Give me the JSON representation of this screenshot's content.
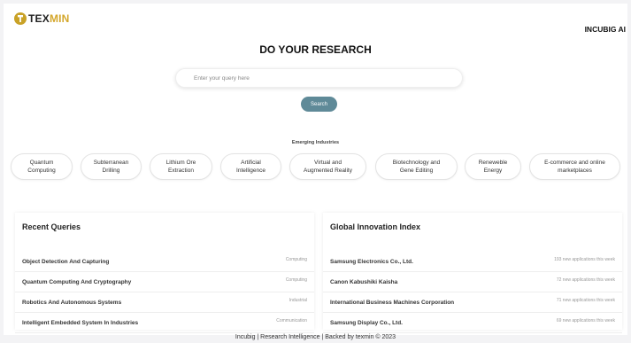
{
  "header": {
    "logo_text_main": "TEX",
    "logo_text_accent": "MIN",
    "brand_right": "INCUBIG AI"
  },
  "hero": {
    "title": "DO YOUR RESEARCH",
    "search_placeholder": "Enter your query here",
    "search_value": "",
    "search_button": "Search"
  },
  "emerging": {
    "label": "Emerging Industries",
    "chips": [
      [
        "Quantum",
        "Computing"
      ],
      [
        "Subterranean",
        "Drilling"
      ],
      [
        "Lithium Ore",
        "Extraction"
      ],
      [
        "Artificial",
        "Intelligence"
      ],
      [
        "Virtual and",
        "Augmented Reality"
      ],
      [
        "Biotechnology and",
        "Gene Editing"
      ],
      [
        "Reneweble",
        "Energy"
      ],
      [
        "E-commerce and online",
        "marketplaces"
      ]
    ]
  },
  "recent_queries": {
    "title": "Recent Queries",
    "rows": [
      {
        "name": "Object Detection And Capturing",
        "meta": "Computing"
      },
      {
        "name": "Quantum Computing And Cryptography",
        "meta": "Computing"
      },
      {
        "name": "Robotics And Autonomous Systems",
        "meta": "Industrial"
      },
      {
        "name": "Intelligent Embedded System In Industries",
        "meta": "Communication"
      }
    ]
  },
  "global_index": {
    "title": "Global Innovation Index",
    "rows": [
      {
        "name": "Samsung Electronics Co., Ltd.",
        "meta": "193 new applications this week"
      },
      {
        "name": "Canon Kabushiki Kaisha",
        "meta": "72 new applications this week"
      },
      {
        "name": "International Business Machines Corporation",
        "meta": "71 new applications this week"
      },
      {
        "name": "Samsung Display Co., Ltd.",
        "meta": "69 new applications this week"
      }
    ]
  },
  "footer": {
    "text": "Incubig | Research Intelligence | Backed by texmin © 2023"
  },
  "colors": {
    "accent": "#d4a72c",
    "button": "#5f8a98"
  }
}
